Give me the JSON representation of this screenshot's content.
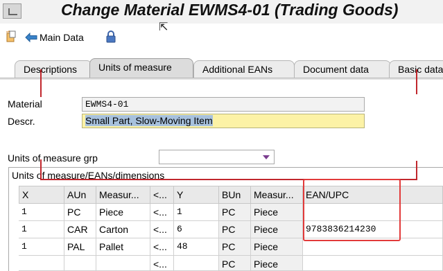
{
  "window": {
    "title": "Change Material EWMS4-01 (Trading Goods)"
  },
  "toolbar": {
    "main_data_label": "Main Data"
  },
  "tabs": [
    {
      "label": "Descriptions"
    },
    {
      "label": "Units of measure"
    },
    {
      "label": "Additional EANs"
    },
    {
      "label": "Document data"
    },
    {
      "label": "Basic data"
    }
  ],
  "form": {
    "material_label": "Material",
    "material_value": "EWMS4-01",
    "descr_label": "Descr.",
    "descr_value": "Small Part, Slow-Moving Item",
    "uom_grp_label": "Units of measure grp",
    "uom_grp_value": ""
  },
  "section": {
    "title": "Units of measure/EANs/dimensions"
  },
  "table": {
    "columns": [
      "X",
      "AUn",
      "Measur...",
      "<...",
      "Y",
      "BUn",
      "Measur...",
      "EAN/UPC"
    ],
    "rows": [
      [
        "1",
        "PC",
        "Piece",
        "<...",
        "1",
        "PC",
        "Piece",
        ""
      ],
      [
        "1",
        "CAR",
        "Carton",
        "<...",
        "6",
        "PC",
        "Piece",
        "9783836214230"
      ],
      [
        "1",
        "PAL",
        "Pallet",
        "<...",
        "48",
        "PC",
        "Piece",
        ""
      ],
      [
        "",
        "",
        "",
        "<...",
        "",
        "PC",
        "Piece",
        ""
      ]
    ]
  },
  "colors": {
    "annotation": "#e23a3a",
    "highlight_field": "#fcf2a6",
    "selection": "#a7c1dd"
  }
}
